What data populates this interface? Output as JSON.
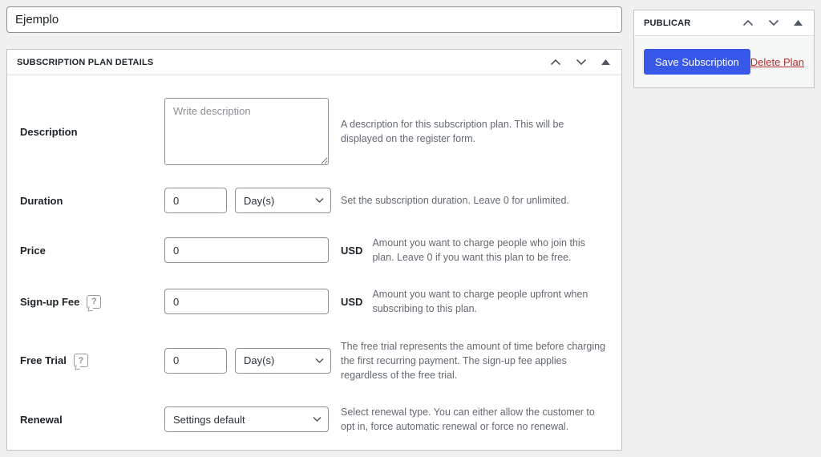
{
  "colors": {
    "page_background": "#f0f0f1",
    "save_button_bg": "#3858e9",
    "delete_link": "#b32d2e",
    "box_border": "#c3c4c7",
    "help_text": "#646970"
  },
  "title_input": {
    "value": "Ejemplo"
  },
  "publish_box": {
    "title": "PUBLICAR",
    "save_button": "Save Subscription",
    "delete_link": "Delete Plan"
  },
  "details_box": {
    "title": "SUBSCRIPTION PLAN DETAILS",
    "rows": [
      {
        "label": "Description",
        "placeholder": "Write description",
        "help": "A description for this subscription plan. This will be displayed on the register form."
      },
      {
        "label": "Duration",
        "value": "0",
        "select": "Day(s)",
        "help": "Set the subscription duration. Leave 0 for unlimited."
      },
      {
        "label": "Price",
        "value": "0",
        "currency": "USD",
        "help": "Amount you want to charge people who join this plan. Leave 0 if you want this plan to be free."
      },
      {
        "label": "Sign-up Fee",
        "value": "0",
        "currency": "USD",
        "help": "Amount you want to charge people upfront when subscribing to this plan."
      },
      {
        "label": "Free Trial",
        "value": "0",
        "select": "Day(s)",
        "help": "The free trial represents the amount of time before charging the first recurring payment. The sign-up fee applies regardless of the free trial."
      },
      {
        "label": "Renewal",
        "select": "Settings default",
        "help": "Select renewal type. You can either allow the customer to opt in, force automatic renewal or force no renewal."
      }
    ]
  }
}
